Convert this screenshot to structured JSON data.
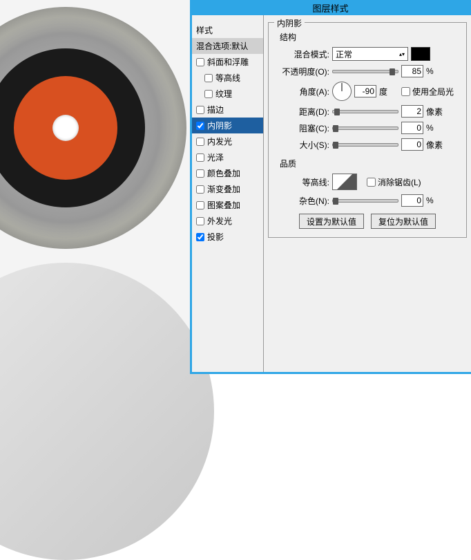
{
  "dialog": {
    "title": "图层样式"
  },
  "styles": {
    "header": "样式",
    "blending_defaults": "混合选项:默认",
    "items": [
      {
        "label": "斜面和浮雕",
        "checked": false,
        "indent": false
      },
      {
        "label": "等高线",
        "checked": false,
        "indent": true
      },
      {
        "label": "纹理",
        "checked": false,
        "indent": true
      },
      {
        "label": "描边",
        "checked": false,
        "indent": false
      },
      {
        "label": "内阴影",
        "checked": true,
        "indent": false,
        "selected": true
      },
      {
        "label": "内发光",
        "checked": false,
        "indent": false
      },
      {
        "label": "光泽",
        "checked": false,
        "indent": false
      },
      {
        "label": "颜色叠加",
        "checked": false,
        "indent": false
      },
      {
        "label": "渐变叠加",
        "checked": false,
        "indent": false
      },
      {
        "label": "图案叠加",
        "checked": false,
        "indent": false
      },
      {
        "label": "外发光",
        "checked": false,
        "indent": false
      },
      {
        "label": "投影",
        "checked": true,
        "indent": false
      }
    ]
  },
  "settings": {
    "group_title": "内阴影",
    "structure": {
      "title": "结构",
      "blend_mode_label": "混合模式:",
      "blend_mode_value": "正常",
      "opacity_label": "不透明度(O):",
      "opacity_value": "85",
      "opacity_unit": "%",
      "angle_label": "角度(A):",
      "angle_value": "-90",
      "angle_unit": "度",
      "global_light_label": "使用全局光",
      "distance_label": "距离(D):",
      "distance_value": "2",
      "distance_unit": "像素",
      "choke_label": "阻塞(C):",
      "choke_value": "0",
      "choke_unit": "%",
      "size_label": "大小(S):",
      "size_value": "0",
      "size_unit": "像素"
    },
    "quality": {
      "title": "品质",
      "contour_label": "等高线:",
      "antialias_label": "消除锯齿(L)",
      "noise_label": "杂色(N):",
      "noise_value": "0",
      "noise_unit": "%"
    },
    "buttons": {
      "set_default": "设置为默认值",
      "reset_default": "复位为默认值"
    }
  }
}
